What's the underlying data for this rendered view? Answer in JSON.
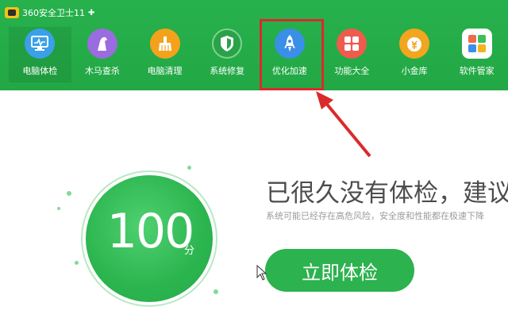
{
  "app": {
    "title": "360安全卫士11"
  },
  "nav": {
    "items": [
      {
        "label": "电脑体检",
        "icon": "monitor-icon",
        "color": "#3aa0e8"
      },
      {
        "label": "木马查杀",
        "icon": "horse-icon",
        "color": "#9b6be0"
      },
      {
        "label": "电脑清理",
        "icon": "broom-icon",
        "color": "#f4a21b"
      },
      {
        "label": "系统修复",
        "icon": "shield-icon",
        "color": "#2aa24a"
      },
      {
        "label": "优化加速",
        "icon": "rocket-icon",
        "color": "#3a8fe6"
      },
      {
        "label": "功能大全",
        "icon": "grid-icon",
        "color": "#ef5b4d"
      },
      {
        "label": "小金库",
        "icon": "coin-icon",
        "color": "#f2a51e"
      },
      {
        "label": "软件管家",
        "icon": "apps-icon",
        "color": "#f06b4a"
      }
    ],
    "active_index": 0,
    "highlighted_index": 4
  },
  "score": {
    "value": "100",
    "unit": "分"
  },
  "main": {
    "headline": "已很久没有体检，建议立即体检",
    "subline": "系统可能已经存在高危风险，安全度和性能都在极速下降",
    "check_button": "立即体检"
  },
  "colors": {
    "toolbar_green": "#27b14c",
    "highlight_red": "#d92b2b",
    "button_green": "#2cb24f"
  }
}
